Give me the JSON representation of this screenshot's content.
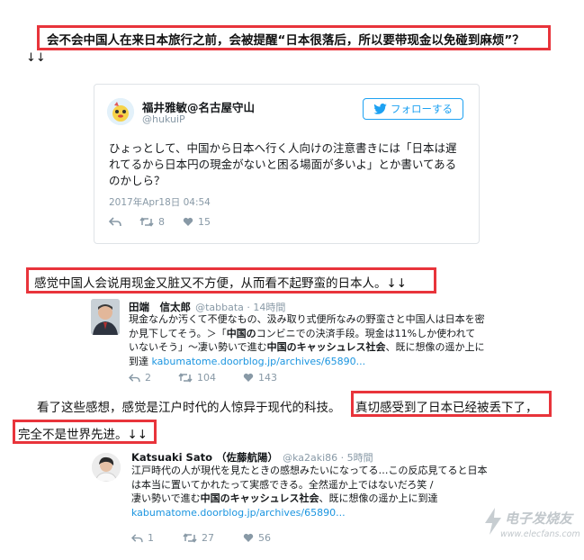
{
  "caption1": "会不会中国人在来日本旅行之前，会被提醒“日本很落后，所以要带现金以免碰到麻烦”？",
  "arrows": "↓↓",
  "tweet1": {
    "name": "福井雅敏@名古屋守山",
    "handle": "@hukuiP",
    "follow_label": "フォローする",
    "text": "ひょっとして、中国から日本へ行く人向けの注意書きには「日本は遅れてるから日本円の現金がないと困る場面が多いよ」とか書いてあるのかしら？",
    "timestamp": "2017年Apr18日 04:54",
    "retweets": "8",
    "likes": "15"
  },
  "caption2": "感觉中国人会说用现金又脏又不方便，从而看不起野蛮的日本人。↓↓",
  "tweet2": {
    "name": "田端　信太郎",
    "handle": "@tabbata · 14時間",
    "line1": "現金なんか汚くて不便なもの、汲み取り式便所なみの野蛮さと中国人は日本を密",
    "line2": "か見下してそう。＞「",
    "line2_bold": "中国の",
    "line2_rest": "コンビニでの決済手段。現金は11%しか使われて",
    "line3_a": "いないそう」〜凄い勢いで進む",
    "line3_bold": "中国のキャッシュレス社会",
    "line3_b": "、既に想像の遥か上に",
    "line4_a": "到達 ",
    "link": "kabumatome.doorblog.jp/archives/65890...",
    "replies": "2",
    "retweets": "104",
    "likes": "143"
  },
  "caption3_a": "看了这些感想，感觉是江户时代的人惊异于现代的科技。",
  "caption3_b": "真切感受到了日本已经被丢下了，",
  "caption3_c": "完全不是世界先进。↓↓",
  "tweet3": {
    "name": "Katsuaki Sato （佐藤航陽）",
    "handle": "@ka2aki86 · 5時間",
    "line1": "江戸時代の人が現代を見たときの感想みたいになってる…この反応見てると日本",
    "line2": "は本当に置いてかれたって実感できる。全然遥か上ではないだろ笑 /",
    "line3_a": "凄い勢いで進む",
    "line3_bold": "中国のキャッシュレス社会",
    "line3_b": "、既に想像の遥か上に到達",
    "link": "kabumatome.doorblog.jp/archives/65890...",
    "replies": "1",
    "retweets": "27",
    "likes": "56"
  },
  "watermark": "www.elecfans.com",
  "watermark_cn": "电子发烧友",
  "colors": {
    "highlight_red": "#e8343b",
    "twitter_blue": "#1da1f2",
    "link_blue": "#1b95e0",
    "muted": "#8899a6"
  }
}
